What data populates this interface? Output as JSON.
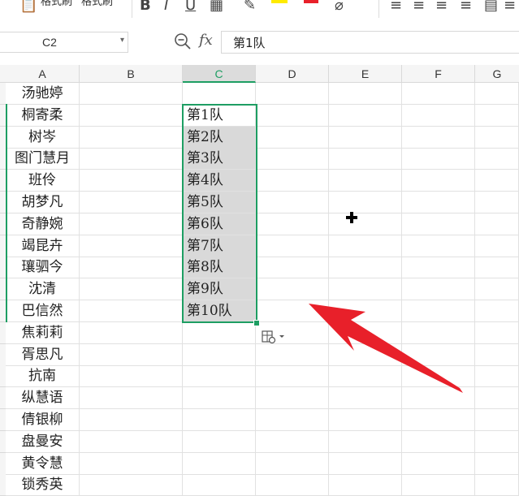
{
  "toolbar": {
    "items": [
      "格式刷",
      "格式刷"
    ],
    "paste_label": "格式刷",
    "format_painter_label": "格式刷"
  },
  "formula_bar": {
    "name_box": "C2",
    "fx_label": "fx",
    "formula": "第1队"
  },
  "columns": [
    "A",
    "B",
    "C",
    "D",
    "E",
    "F",
    "G"
  ],
  "active_column": "C",
  "names": [
    "汤驰婷",
    "桐寄柔",
    "树岑",
    "图门慧月",
    "班伶",
    "胡梦凡",
    "奇静婉",
    "竭昆卉",
    "瓖驷今",
    "沈清",
    "巴信然",
    "焦莉莉",
    "胥思凡",
    "抗南",
    "纵慧语",
    "倩银柳",
    "盘曼安",
    "黄令慧",
    "锁秀英"
  ],
  "teams": [
    "第1队",
    "第2队",
    "第3队",
    "第4队",
    "第5队",
    "第6队",
    "第7队",
    "第8队",
    "第9队",
    "第10队"
  ],
  "colors": {
    "accent": "#1e9e63",
    "selection_fill": "#d9d9d9",
    "arrow": "#e8202a"
  }
}
